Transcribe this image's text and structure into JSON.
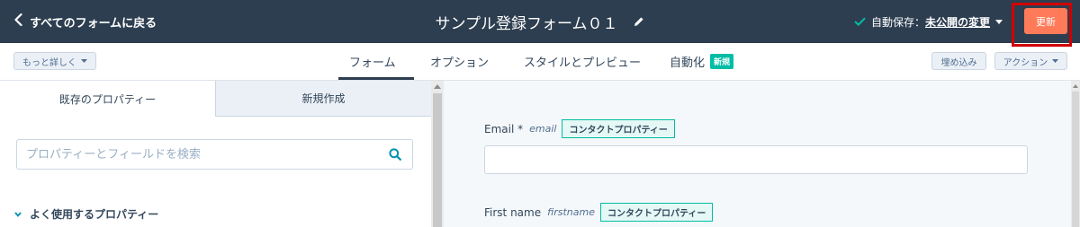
{
  "topbar": {
    "back_label": "すべてのフォームに戻る",
    "form_title": "サンプル登録フォーム０１",
    "autosave_prefix": "自動保存：",
    "autosave_status": "未公開の変更",
    "update_button": "更新"
  },
  "toolbar": {
    "more_details": "もっと詳しく",
    "tabs": [
      "フォーム",
      "オプション",
      "スタイルとプレビュー",
      "自動化"
    ],
    "new_badge": "新規",
    "embed": "埋め込み",
    "actions": "アクション"
  },
  "left_panel": {
    "tabs": [
      "既存のプロパティー",
      "新規作成"
    ],
    "search_placeholder": "プロパティーとフィールドを検索",
    "section_title": "よく使用するプロパティー"
  },
  "form_preview": {
    "fields": [
      {
        "label": "Email *",
        "internal_name": "email",
        "tag": "コンタクトプロパティー"
      },
      {
        "label": "First name",
        "internal_name": "firstname",
        "tag": "コンタクトプロパティー"
      }
    ]
  },
  "colors": {
    "topbar": "#2d3e50",
    "accent_orange": "#ff7a59",
    "teal": "#00bda5",
    "highlight_red": "#d10000"
  }
}
